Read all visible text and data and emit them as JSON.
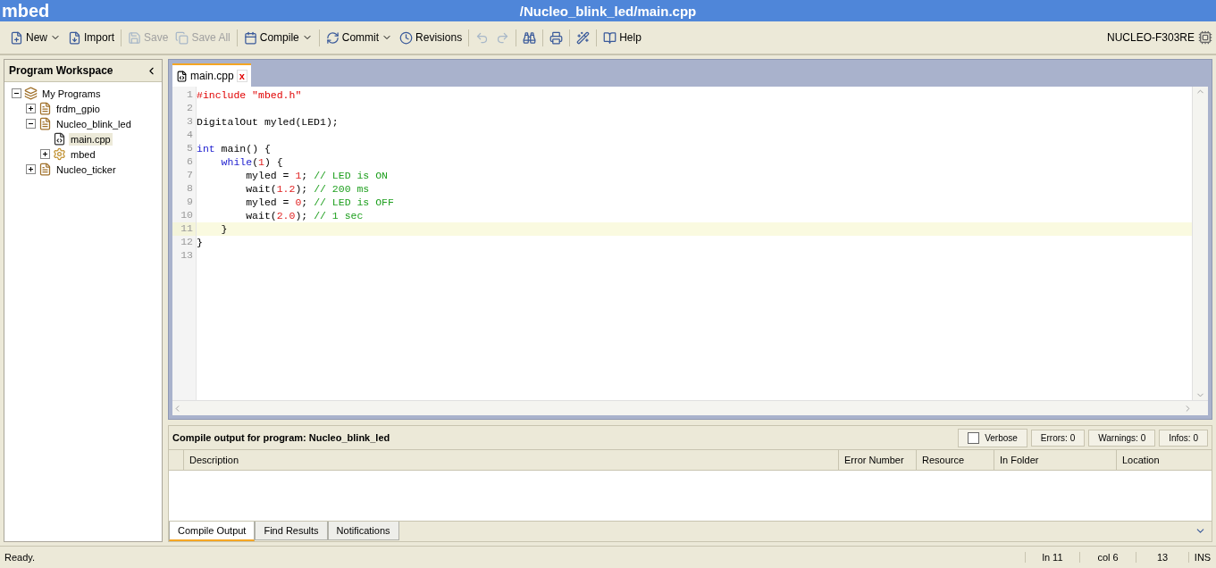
{
  "app": {
    "logo": "mbed",
    "title": "/Nucleo_blink_led/main.cpp"
  },
  "toolbar": [
    [
      {
        "label": "New",
        "disabled": false,
        "dropdown": true
      },
      {
        "label": "Import",
        "disabled": false,
        "dropdown": false
      }
    ],
    [
      {
        "label": "Save",
        "disabled": true,
        "dropdown": false
      },
      {
        "label": "Save All",
        "disabled": true,
        "dropdown": false
      }
    ],
    [
      {
        "label": "Compile",
        "disabled": false,
        "dropdown": true
      }
    ],
    [
      {
        "label": "Commit",
        "disabled": false,
        "dropdown": true
      },
      {
        "label": "Revisions",
        "disabled": false,
        "dropdown": false
      }
    ],
    [
      {
        "disabled": true,
        "dropdown": false
      },
      {
        "disabled": true,
        "dropdown": false
      }
    ],
    [
      {
        "disabled": false,
        "dropdown": false
      }
    ],
    [
      {
        "disabled": false,
        "dropdown": false
      }
    ],
    [
      {
        "disabled": false,
        "dropdown": false
      }
    ],
    [
      {
        "label": "Help",
        "disabled": false,
        "dropdown": false
      }
    ]
  ],
  "platform": "NUCLEO-F303RE",
  "sidebar": {
    "title": "Program Workspace",
    "tree": [
      {
        "label": "My Programs",
        "kind": "root",
        "expanded": true,
        "selected": false,
        "children": [
          {
            "label": "frdm_gpio",
            "kind": "program",
            "expanded": false,
            "selected": false
          },
          {
            "label": "Nucleo_blink_led",
            "kind": "program",
            "expanded": true,
            "selected": false,
            "children": [
              {
                "label": "main.cpp",
                "kind": "file",
                "selected": true
              },
              {
                "label": "mbed",
                "kind": "library",
                "expanded": false,
                "selected": false
              }
            ]
          },
          {
            "label": "Nucleo_ticker",
            "kind": "program",
            "expanded": false,
            "selected": false
          }
        ]
      }
    ]
  },
  "editor": {
    "tabs": [
      {
        "label": "main.cpp",
        "selected": true,
        "close": "x"
      }
    ],
    "lines": [
      {
        "number": "1",
        "current": false,
        "tokens": [
          {
            "kind": "pre",
            "text": "#include \"mbed.h\""
          }
        ]
      },
      {
        "number": "2",
        "current": false
      },
      {
        "number": "3",
        "current": false,
        "tokens": [
          {
            "kind": "plain",
            "text": "DigitalOut myled(LED1);"
          }
        ]
      },
      {
        "number": "4",
        "current": false
      },
      {
        "number": "5",
        "current": false,
        "tokens": [
          {
            "kind": "keyword",
            "text": "int"
          },
          {
            "kind": "plain",
            "text": " main() {"
          }
        ]
      },
      {
        "number": "6",
        "current": false,
        "tokens": [
          {
            "kind": "keyword",
            "text": "    while"
          },
          {
            "kind": "plain",
            "text": "("
          },
          {
            "kind": "number",
            "text": "1"
          },
          {
            "kind": "plain",
            "text": ") {"
          }
        ]
      },
      {
        "number": "7",
        "current": false,
        "tokens": [
          {
            "kind": "plain",
            "text": "        myled = "
          },
          {
            "kind": "number",
            "text": "1"
          },
          {
            "kind": "plain",
            "text": "; "
          },
          {
            "kind": "comment",
            "text": "// LED is ON"
          }
        ]
      },
      {
        "number": "8",
        "current": false,
        "tokens": [
          {
            "kind": "plain",
            "text": "        wait("
          },
          {
            "kind": "number",
            "text": "1.2"
          },
          {
            "kind": "plain",
            "text": "); "
          },
          {
            "kind": "comment",
            "text": "// 200 ms"
          }
        ]
      },
      {
        "number": "9",
        "current": false,
        "tokens": [
          {
            "kind": "plain",
            "text": "        myled = "
          },
          {
            "kind": "number",
            "text": "0"
          },
          {
            "kind": "plain",
            "text": "; "
          },
          {
            "kind": "comment",
            "text": "// LED is OFF"
          }
        ]
      },
      {
        "number": "10",
        "current": false,
        "tokens": [
          {
            "kind": "plain",
            "text": "        wait("
          },
          {
            "kind": "number",
            "text": "2.0"
          },
          {
            "kind": "plain",
            "text": "); "
          },
          {
            "kind": "comment",
            "text": "// 1 sec"
          }
        ]
      },
      {
        "number": "11",
        "current": true,
        "tokens": [
          {
            "kind": "plain",
            "text": "    }"
          }
        ]
      },
      {
        "number": "12",
        "current": false,
        "tokens": [
          {
            "kind": "plain",
            "text": "}"
          }
        ]
      },
      {
        "number": "13",
        "current": false
      }
    ]
  },
  "output": {
    "title": "Compile output for program: Nucleo_blink_led",
    "verbose": {
      "label": "Verbose",
      "checked": false
    },
    "counters": [
      "Errors: 0",
      "Warnings: 0",
      "Infos: 0"
    ],
    "columns": [
      "Description",
      "Error Number",
      "Resource",
      "In Folder",
      "Location"
    ],
    "tabs": [
      {
        "label": "Compile Output",
        "selected": true
      },
      {
        "label": "Find Results",
        "selected": false
      },
      {
        "label": "Notifications",
        "selected": false
      }
    ]
  },
  "status_bar": {
    "message": "Ready.",
    "cells": [
      "ln 11",
      "col 6",
      "13",
      "INS"
    ]
  }
}
